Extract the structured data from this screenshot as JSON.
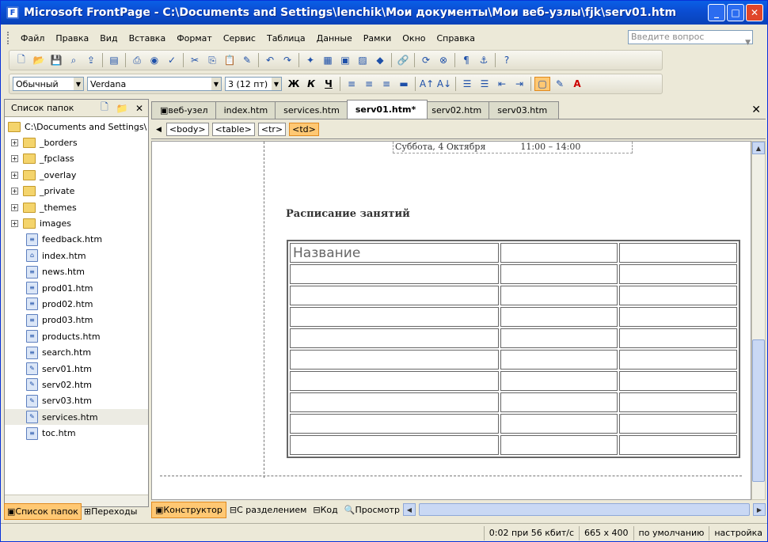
{
  "window": {
    "title": "Microsoft FrontPage - C:\\Documents and Settings\\lenchik\\Мои документы\\Мои веб-узлы\\fjk\\serv01.htm",
    "minimize": "_",
    "maximize": "□",
    "close": "✕"
  },
  "menu": {
    "items": [
      "Файл",
      "Правка",
      "Вид",
      "Вставка",
      "Формат",
      "Сервис",
      "Таблица",
      "Данные",
      "Рамки",
      "Окно",
      "Справка"
    ],
    "ask_placeholder": "Введите вопрос"
  },
  "toolbar": {
    "style": "Обычный",
    "font": "Verdana",
    "size": "3 (12 пт)",
    "bold": "Ж",
    "italic": "К",
    "underline": "Ч"
  },
  "folder_list": {
    "title": "Список папок",
    "root": "C:\\Documents and Settings\\",
    "items": [
      {
        "label": "_borders",
        "type": "folder"
      },
      {
        "label": "_fpclass",
        "type": "folder"
      },
      {
        "label": "_overlay",
        "type": "folder"
      },
      {
        "label": "_private",
        "type": "folder"
      },
      {
        "label": "_themes",
        "type": "folder"
      },
      {
        "label": "images",
        "type": "folder"
      },
      {
        "label": "feedback.htm",
        "type": "page"
      },
      {
        "label": "index.htm",
        "type": "page"
      },
      {
        "label": "news.htm",
        "type": "page"
      },
      {
        "label": "prod01.htm",
        "type": "page"
      },
      {
        "label": "prod02.htm",
        "type": "page"
      },
      {
        "label": "prod03.htm",
        "type": "page"
      },
      {
        "label": "products.htm",
        "type": "page"
      },
      {
        "label": "search.htm",
        "type": "page"
      },
      {
        "label": "serv01.htm",
        "type": "page"
      },
      {
        "label": "serv02.htm",
        "type": "page"
      },
      {
        "label": "serv03.htm",
        "type": "page"
      },
      {
        "label": "services.htm",
        "type": "page"
      },
      {
        "label": "toc.htm",
        "type": "page"
      }
    ]
  },
  "left_tabs": {
    "folders": "Список папок",
    "nav": "Переходы"
  },
  "doc_tabs": [
    "веб-узел",
    "index.htm",
    "services.htm",
    "serv01.htm*",
    "serv02.htm",
    "serv03.htm"
  ],
  "tag_path": [
    "<body>",
    "<table>",
    "<tr>",
    "<td>"
  ],
  "page": {
    "date": "Суббота, 4 Октября",
    "time": "11:00 – 14:00",
    "heading": "Расписание занятий",
    "table_header": "Название",
    "rows": 10,
    "cols": 3
  },
  "modes": {
    "design": "Конструктор",
    "split": "С разделением",
    "code": "Код",
    "preview": "Просмотр"
  },
  "status": {
    "download": "0:02 при 56 кбит/с",
    "size": "665 x 400",
    "default": "по умолчанию",
    "custom": "настройка"
  }
}
